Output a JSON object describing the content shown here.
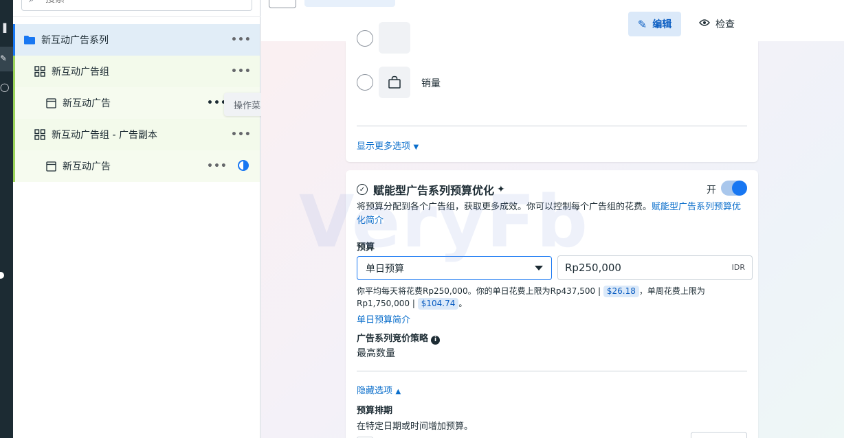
{
  "sidebar": {
    "search_placeholder": "搜索"
  },
  "tree": {
    "campaign": {
      "label": "新互动广告系列",
      "more": "•••"
    },
    "adset1": {
      "label": "新互动广告组",
      "more": "•••"
    },
    "ad1": {
      "label": "新互动广告",
      "more": "•••"
    },
    "adset2": {
      "label": "新互动广告组 - 广告副本",
      "more": "•••"
    },
    "ad2": {
      "label": "新互动广告",
      "more": "•••"
    }
  },
  "tooltip": {
    "text": "操作菜单"
  },
  "toolbar": {
    "edit_label": "编辑",
    "review_label": "检查"
  },
  "goal_card": {
    "option_sales": "销量",
    "show_more": "显示更多选项"
  },
  "cbo_card": {
    "title": "赋能型广告系列预算优化",
    "toggle_label": "开",
    "toggle_on": true,
    "description": "将预算分配到各个广告组，获取更多成效。你可以控制每个广告组的花费。",
    "description_link": "赋能型广告系列预算优化简介",
    "budget_label": "预算",
    "budget_type": "单日预算",
    "budget_amount": "Rp250,000",
    "currency": "IDR",
    "info_part1": "你平均每天将花费Rp250,000。你的单日花费上限为Rp437,500 |",
    "info_badge1": "$26.18",
    "info_part2": "，单周花费上限为Rp1,750,000 |",
    "info_badge2": "$104.74",
    "info_end": "。",
    "daily_link": "单日预算简介",
    "bid_label": "广告系列竞价策略",
    "bid_value": "最高数量",
    "hide_options": "隐藏选项",
    "schedule_label": "预算排期",
    "schedule_desc": "在特定日期或时间增加预算。"
  },
  "watermark": "VeryFb",
  "colors": {
    "accent": "#1877f2",
    "link": "#0a6ecb",
    "rail": "#1c2b33",
    "campaign_row": "#e1edf7",
    "adset_row": "#f3faeb"
  }
}
